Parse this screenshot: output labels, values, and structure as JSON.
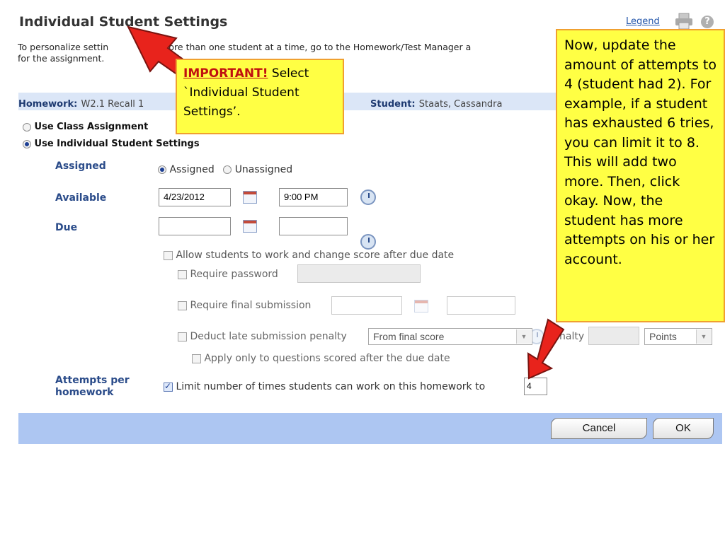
{
  "header": {
    "title": "Individual Student Settings",
    "legend": "Legend",
    "help_glyph": "?",
    "intro_line1": "To personalize settin",
    "intro_line1b": "more than one student at a time, go to the Homework/Test Manager a",
    "intro_line2": "for the assignment."
  },
  "info": {
    "homework_label": "Homework:",
    "homework_value": "W2.1 Recall 1",
    "student_label": "Student:",
    "student_value": "Staats, Cassandra"
  },
  "options": {
    "class_label": "Use Class Assignment",
    "individual_label": "Use Individual Student Settings",
    "selected": "individual"
  },
  "form": {
    "assigned_label": "Assigned",
    "assigned_opt": "Assigned",
    "unassigned_opt": "Unassigned",
    "available_label": "Available",
    "available_date": "4/23/2012",
    "available_time": "9:00 PM",
    "due_label": "Due",
    "due_date": "",
    "due_time": "",
    "allow_late": "Allow students to work and change score after due date",
    "require_password": "Require password",
    "require_final": "Require final submission",
    "deduct_late": "Deduct late submission penalty",
    "deduct_select": "From final score",
    "penalty_partial": "nalty",
    "points_select": "Points",
    "apply_only": "Apply only to questions scored after the due date",
    "attempts_label_1": "Attempts per",
    "attempts_label_2": "homework",
    "limit_text": "Limit number of times students can work on this homework to",
    "limit_value": "4"
  },
  "footer": {
    "cancel": "Cancel",
    "ok": "OK"
  },
  "callouts": {
    "c1_important": "IMPORTANT!",
    "c1_text": " Select `Individual Student Settings’.",
    "c2_text": "Now, update the amount of attempts to 4 (student had 2). For example, if a student has exhausted 6 tries, you can limit it to 8. This will add two more. Then, click okay. Now, the student has more attempts on his or her account."
  },
  "colors": {
    "arrow": "#e8231c",
    "callout_bg": "#ffff44",
    "footer_bg": "#adc6f2"
  }
}
